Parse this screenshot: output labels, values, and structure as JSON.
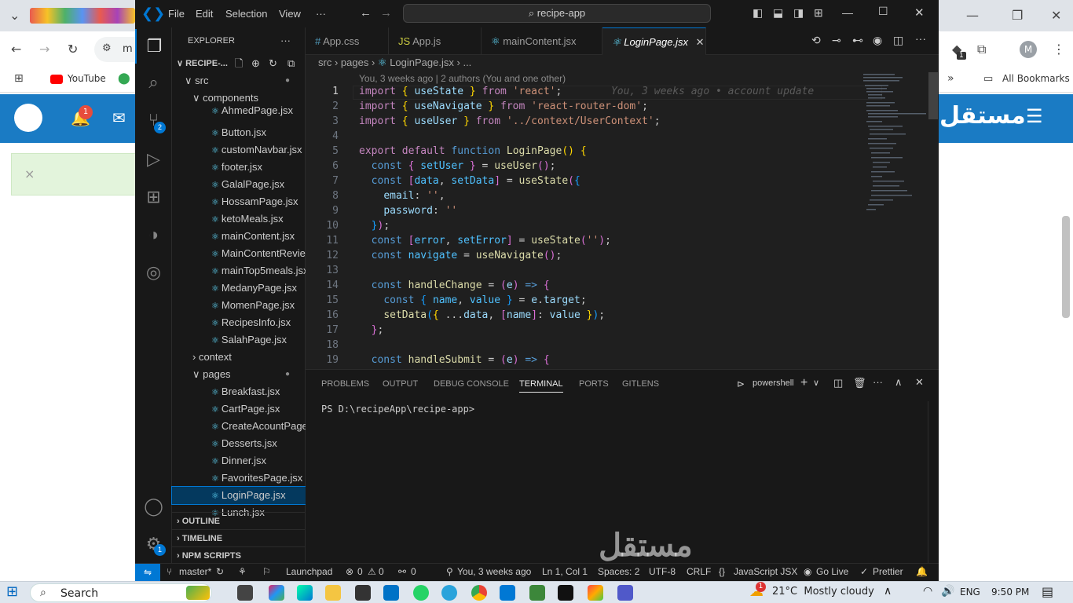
{
  "browser": {
    "youtube": "YouTube",
    "all_bookmarks": "All Bookmarks",
    "address_partial": "m",
    "notif_count": "1",
    "ext_badge": "1",
    "profile_initial": "M",
    "alert_close": "×",
    "site_logo": "مستقل"
  },
  "vscode": {
    "menu": [
      "File",
      "Edit",
      "Selection",
      "View",
      "···"
    ],
    "command_center": "recipe-app",
    "explorer_title": "EXPLORER",
    "explorer_more": "···",
    "project": "RECIPE-...",
    "scm_badge": "2",
    "settings_badge": "1",
    "tree": [
      {
        "label": "src",
        "chevron": "∨",
        "dot": true
      },
      {
        "label": "components",
        "chevron": "∨",
        "dot": false
      },
      {
        "label": "AhmedPage.jsx"
      },
      {
        "label": "Button.jsx"
      },
      {
        "label": "customNavbar.jsx"
      },
      {
        "label": "footer.jsx"
      },
      {
        "label": "GalalPage.jsx"
      },
      {
        "label": "HossamPage.jsx"
      },
      {
        "label": "ketoMeals.jsx"
      },
      {
        "label": "mainContent.jsx"
      },
      {
        "label": "MainContentRevie..."
      },
      {
        "label": "mainTop5meals.jsx"
      },
      {
        "label": "MedanyPage.jsx"
      },
      {
        "label": "MomenPage.jsx"
      },
      {
        "label": "RecipesInfo.jsx"
      },
      {
        "label": "SalahPage.jsx"
      },
      {
        "label": "context",
        "chevron": "›",
        "dot": false
      },
      {
        "label": "pages",
        "chevron": "∨",
        "dot": true
      },
      {
        "label": "Breakfast.jsx"
      },
      {
        "label": "CartPage.jsx"
      },
      {
        "label": "CreateAcountPage...."
      },
      {
        "label": "Desserts.jsx"
      },
      {
        "label": "Dinner.jsx"
      },
      {
        "label": "FavoritesPage.jsx"
      },
      {
        "label": "LoginPage.jsx"
      },
      {
        "label": "Lunch.jsx"
      }
    ],
    "sections": [
      "OUTLINE",
      "TIMELINE",
      "NPM SCRIPTS"
    ],
    "tabs": [
      "App.css",
      "App.js",
      "mainContent.jsx",
      "LoginPage.jsx"
    ],
    "active_tab_close": "✕",
    "breadcrumb": [
      "src",
      "pages",
      "LoginPage.jsx",
      "..."
    ],
    "blame_header": "You, 3 weeks ago | 2 authors (You and one other)",
    "inline_blame": "You, 3 weeks ago • account update",
    "line_numbers": [
      "1",
      "2",
      "3",
      "4",
      "5",
      "6",
      "7",
      "8",
      "9",
      "10",
      "11",
      "12",
      "13",
      "14",
      "15",
      "16",
      "17",
      "18",
      "19"
    ],
    "panel_tabs": [
      "PROBLEMS",
      "OUTPUT",
      "DEBUG CONSOLE",
      "TERMINAL",
      "PORTS",
      "GITLENS"
    ],
    "terminal_profile": "powershell",
    "terminal_prompt": "PS D:\\recipeApp\\recipe-app>",
    "status": {
      "branch": "master*",
      "launchpad": "Launchpad",
      "errors": "0",
      "warnings": "0",
      "ports": "0",
      "blame": "You, 3 weeks ago",
      "position": "Ln 1, Col 1",
      "spaces": "Spaces: 2",
      "encoding": "UTF-8",
      "eol": "CRLF",
      "language": "JavaScript JSX",
      "golive": "Go Live",
      "prettier": "Prettier"
    }
  },
  "taskbar": {
    "search": "Search",
    "weather": "21°C  Mostly cloudy",
    "weather_badge": "1",
    "lang": "ENG",
    "time": "9:50 PM"
  },
  "watermark": "مستقل"
}
